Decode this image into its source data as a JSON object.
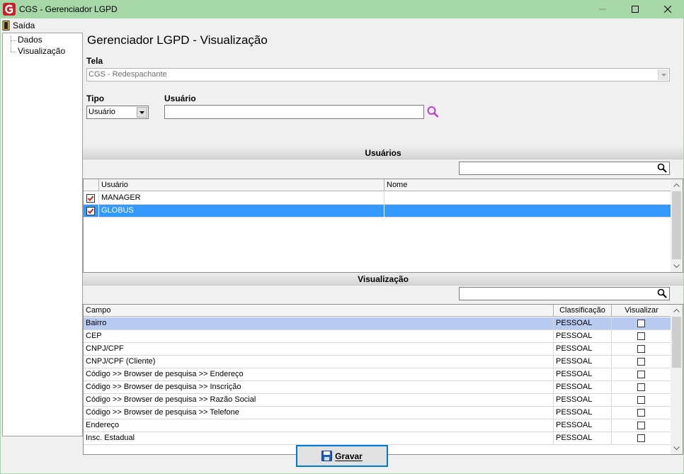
{
  "window": {
    "title": "CGS - Gerenciador LGPD"
  },
  "menu": {
    "exit_label": "Saída"
  },
  "tree": {
    "items": [
      "Dados",
      "Visualização"
    ]
  },
  "page": {
    "title": "Gerenciador LGPD - Visualização"
  },
  "form": {
    "tela_label": "Tela",
    "tela_value": "CGS - Redespachante",
    "tipo_label": "Tipo",
    "tipo_value": "Usuário",
    "usuario_label": "Usuário",
    "usuario_value": ""
  },
  "users_section": {
    "title": "Usuários",
    "search_value": "",
    "columns": [
      "Usuário",
      "Nome"
    ],
    "rows": [
      {
        "usuario": "MANAGER",
        "nome": "",
        "checked": true
      },
      {
        "usuario": "GLOBUS",
        "nome": "",
        "checked": true,
        "selected": true
      }
    ]
  },
  "view_section": {
    "title": "Visualização",
    "search_value": "",
    "columns": [
      "Campo",
      "Classificação",
      "Visualizar"
    ],
    "rows": [
      {
        "campo": "Bairro",
        "classificacao": "PESSOAL",
        "visualizar": false
      },
      {
        "campo": "CEP",
        "classificacao": "PESSOAL",
        "visualizar": false
      },
      {
        "campo": "CNPJ/CPF",
        "classificacao": "PESSOAL",
        "visualizar": false
      },
      {
        "campo": "CNPJ/CPF (Cliente)",
        "classificacao": "PESSOAL",
        "visualizar": false
      },
      {
        "campo": "Código >> Browser de pesquisa >> Endereço",
        "classificacao": "PESSOAL",
        "visualizar": false
      },
      {
        "campo": "Código >> Browser de pesquisa >> Inscrição",
        "classificacao": "PESSOAL",
        "visualizar": false
      },
      {
        "campo": "Código >> Browser de pesquisa >> Razão Social",
        "classificacao": "PESSOAL",
        "visualizar": false
      },
      {
        "campo": "Código >> Browser de pesquisa >> Telefone",
        "classificacao": "PESSOAL",
        "visualizar": false
      },
      {
        "campo": "Endereço",
        "classificacao": "PESSOAL",
        "visualizar": false
      },
      {
        "campo": "Insc. Estadual",
        "classificacao": "PESSOAL",
        "visualizar": false
      }
    ]
  },
  "actions": {
    "save_label": "Gravar"
  },
  "colors": {
    "titlebar": "#a5d7a7",
    "selection": "#3399ff",
    "selection_light": "#b8cbf0",
    "accent": "#0078d7"
  }
}
